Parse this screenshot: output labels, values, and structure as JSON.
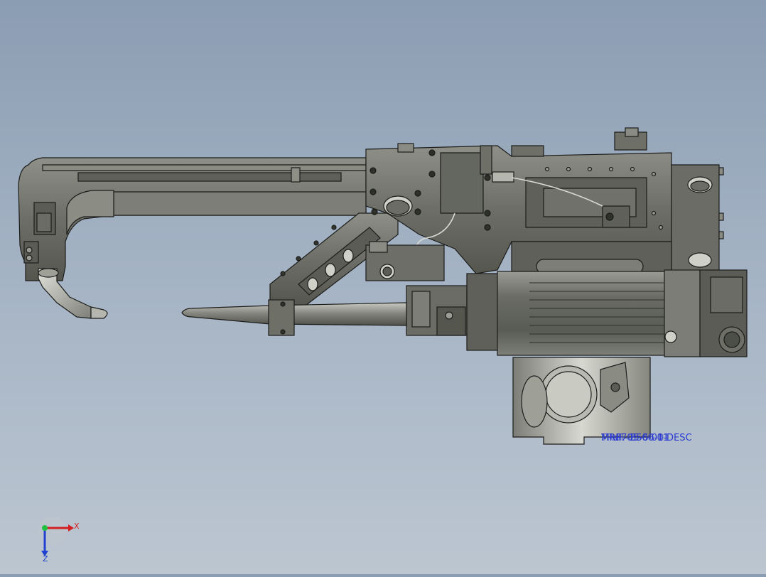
{
  "viewer": {
    "part_label_primary": "MRP7-B56-01-DESC",
    "part_label_overlap_1": "Mhdl-05-00-01",
    "part_label_overlap_2": "TRdF-05-56-01"
  },
  "triad": {
    "x_label": "X",
    "z_label": "Z",
    "x_color": "#d42020",
    "y_color": "#20c040",
    "z_color": "#2040d0"
  },
  "model": {
    "body_color": "#6e7068",
    "highlight_color": "#8a8c84",
    "shadow_color": "#4a4c46",
    "edge_color": "#1c1c1a",
    "motor_color": "#7a7c75",
    "hole_color": "#cfd1c8"
  }
}
